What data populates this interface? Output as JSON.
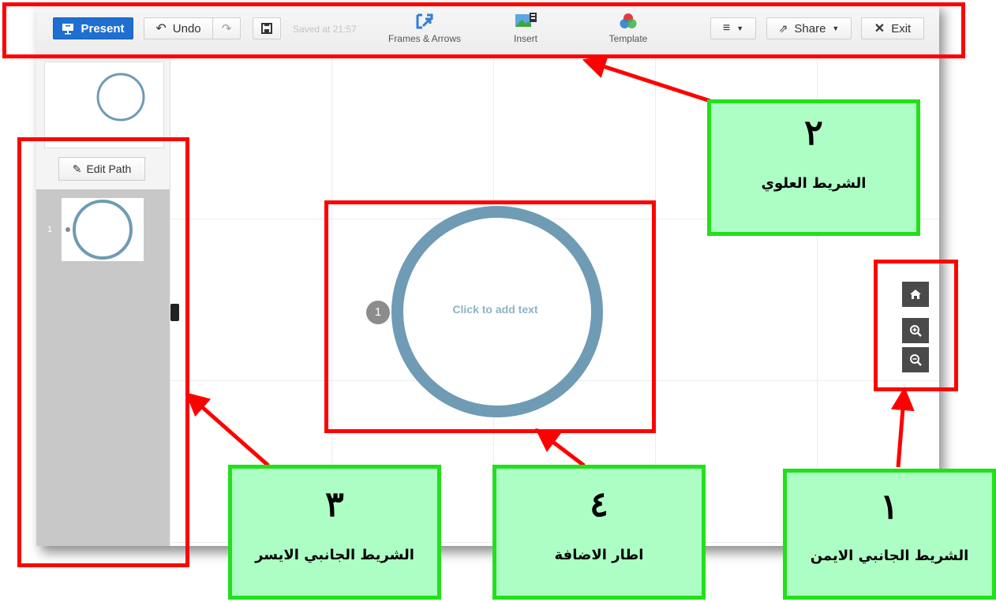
{
  "toolbar": {
    "present_label": "Present",
    "undo_label": "Undo",
    "saved_text": "Saved at 21:57",
    "frames_label": "Frames & Arrows",
    "insert_label": "Insert",
    "template_label": "Template",
    "share_label": "Share",
    "exit_label": "Exit"
  },
  "sidebar": {
    "edit_path_label": "Edit Path",
    "items": [
      {
        "number": "1"
      }
    ]
  },
  "canvas": {
    "placeholder_text": "Click to add text",
    "step_number": "1"
  },
  "zoom_controls": [
    "home-icon",
    "zoom-in-icon",
    "zoom-out-icon"
  ],
  "annotations": [
    {
      "number": "١",
      "label": "الشريط الجانبي الايمن"
    },
    {
      "number": "٢",
      "label": "الشريط العلوي"
    },
    {
      "number": "٣",
      "label": "الشريط الجانبي الايسر"
    },
    {
      "number": "٤",
      "label": "اطار الاضافة"
    }
  ],
  "colors": {
    "present_blue": "#1f6fd1",
    "circle_stroke": "#6f9bb4",
    "highlight_red": "#ff0000",
    "callout_green_border": "#22e01a",
    "callout_green_fill": "#adfec5"
  }
}
